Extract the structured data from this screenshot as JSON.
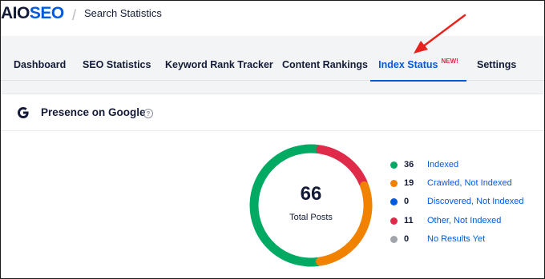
{
  "header": {
    "logo_aio": "AIO",
    "logo_seo": "SEO",
    "separator": "/",
    "title": "Search Statistics"
  },
  "nav": {
    "tabs": [
      {
        "label": "Dashboard"
      },
      {
        "label": "SEO Statistics"
      },
      {
        "label": "Keyword Rank Tracker"
      },
      {
        "label": "Content Rankings"
      },
      {
        "label": "Index Status",
        "badge": "NEW!",
        "active": true
      },
      {
        "label": "Settings"
      }
    ]
  },
  "card": {
    "icon": "google-g-icon",
    "title": "Presence on Google",
    "help": "?"
  },
  "summary": {
    "total": "66",
    "total_label": "Total Posts"
  },
  "statuses": [
    {
      "count": "36",
      "label": "Indexed",
      "color": "#00aa63"
    },
    {
      "count": "19",
      "label": "Crawled, Not Indexed",
      "color": "#f18200"
    },
    {
      "count": "0",
      "label": "Discovered, Not Indexed",
      "color": "#005ae0"
    },
    {
      "count": "11",
      "label": "Other, Not Indexed",
      "color": "#df2a4a"
    },
    {
      "count": "0",
      "label": "No Results Yet",
      "color": "#a1a4ad"
    }
  ],
  "chart_data": {
    "type": "pie",
    "categories": [
      "Indexed",
      "Crawled, Not Indexed",
      "Discovered, Not Indexed",
      "Other, Not Indexed",
      "No Results Yet"
    ],
    "values": [
      36,
      19,
      0,
      11,
      0
    ],
    "colors": [
      "#00aa63",
      "#f18200",
      "#005ae0",
      "#df2a4a",
      "#a1a4ad"
    ],
    "total": 66
  }
}
